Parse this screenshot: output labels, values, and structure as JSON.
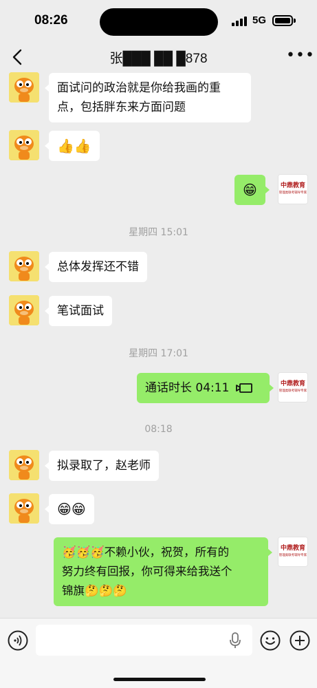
{
  "status_bar": {
    "time": "08:26",
    "network": "5G"
  },
  "nav": {
    "title": "张███ ██ █878",
    "back_icon": "chevron-left-icon",
    "more_icon": "more-dots-icon"
  },
  "messages": [
    {
      "side": "left",
      "text_lines": [
        "面试问的政治就是你给我画的重",
        "点，包括胖东来方面问题"
      ]
    },
    {
      "side": "left",
      "text": "👍👍"
    },
    {
      "side": "right",
      "text": "😁"
    },
    {
      "side": "timestamp",
      "text": "星期四 15:01"
    },
    {
      "side": "left",
      "text": "总体发挥还不错"
    },
    {
      "side": "left",
      "text": "笔试面试"
    },
    {
      "side": "timestamp",
      "text": "星期四 17:01"
    },
    {
      "side": "right",
      "text": "通话时长 04:11",
      "icon": "video-call-icon"
    },
    {
      "side": "timestamp",
      "text": "08:18"
    },
    {
      "side": "left",
      "text": "拟录取了，赵老师"
    },
    {
      "side": "left",
      "text": "😁😁"
    },
    {
      "side": "right",
      "text_lines": [
        "🥳🥳🥳不赖小伙，祝贺，所有的",
        "努力终有回报，你可得来给我送个",
        "锦旗🤔🤔🤔"
      ]
    }
  ],
  "avatars": {
    "contact": "garfield-avatar",
    "self_logo_text": "中鼎教育",
    "self_logo_sub": "管理类联考辅导专家"
  },
  "input_bar": {
    "placeholder": ""
  },
  "colors": {
    "background": "#ededed",
    "sent_bubble": "#95ec69",
    "received_bubble": "#ffffff"
  }
}
